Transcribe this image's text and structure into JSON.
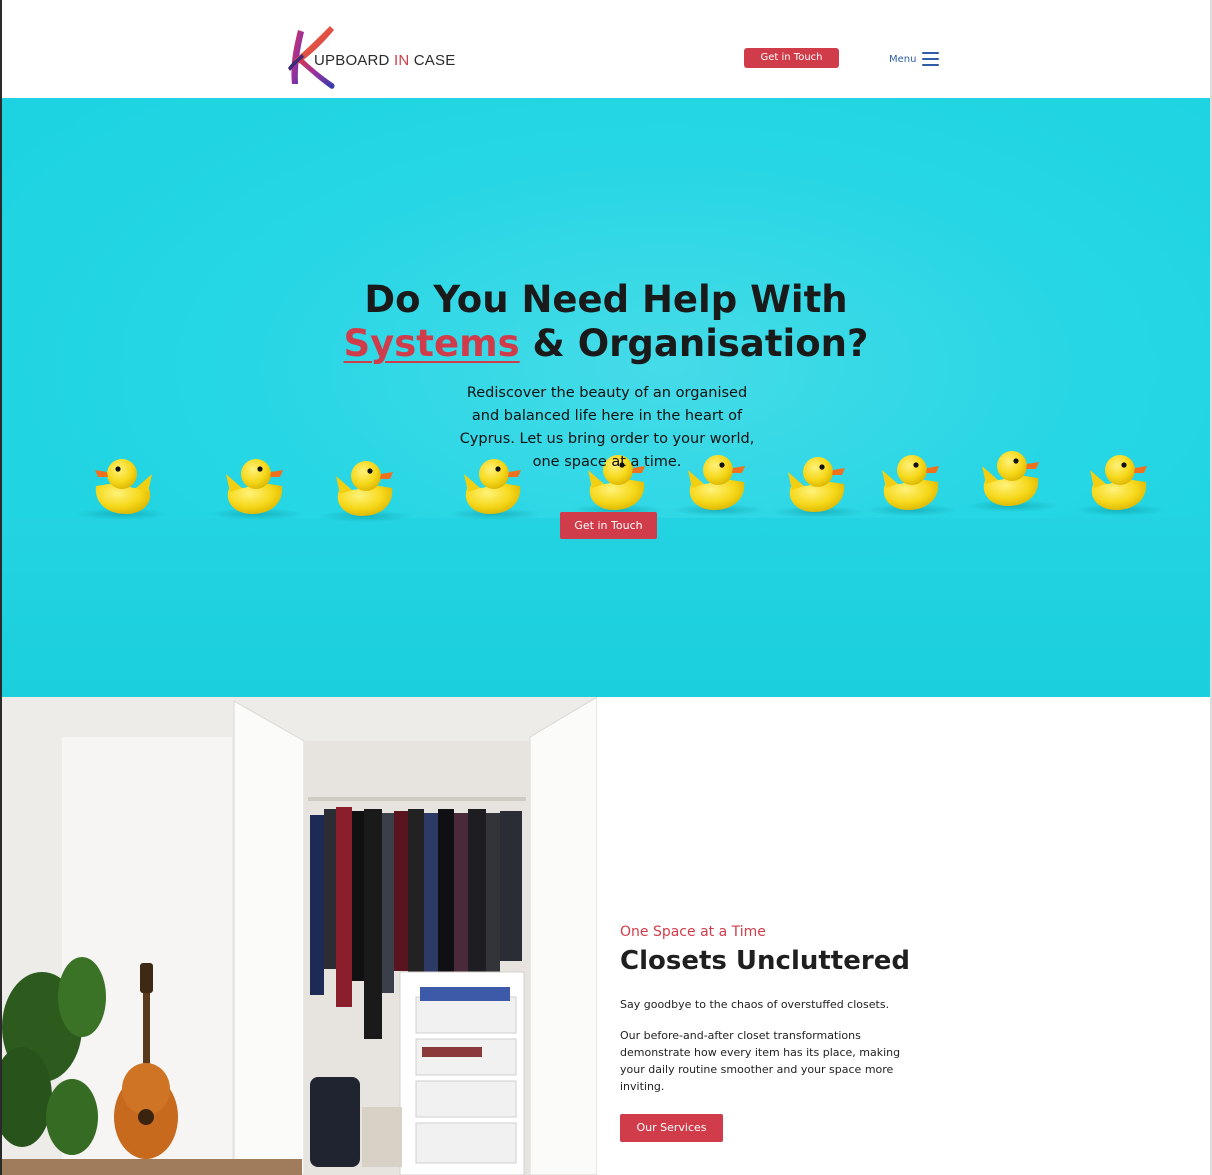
{
  "header": {
    "logo": {
      "text_main": "UPBOARD",
      "text_accent": "IN",
      "text_end": "CASE"
    },
    "cta_label": "Get in Touch",
    "menu_label": "Menu"
  },
  "hero": {
    "title_line1": "Do You Need Help With",
    "title_accent": "Systems",
    "title_line2_rest": " & Organisation?",
    "description": "Rediscover the beauty of an organised and balanced life here in the heart of Cyprus. Let us bring order to your world, one space at a time.",
    "cta_label": "Get in Touch"
  },
  "closets": {
    "eyebrow": "One Space at a Time",
    "title": "Closets Uncluttered",
    "paragraph1": "Say goodbye to the chaos of overstuffed closets.",
    "paragraph2": "Our before-and-after closet transformations demonstrate how every item has its place, making your daily routine smoother and your space more inviting.",
    "cta_label": "Our Services"
  },
  "colors": {
    "brand_red": "#d13c4a",
    "hero_cyan": "#1fd3e1",
    "menu_blue": "#2f5ea8"
  },
  "icons": [
    "logo-k-icon",
    "hamburger-icon"
  ]
}
